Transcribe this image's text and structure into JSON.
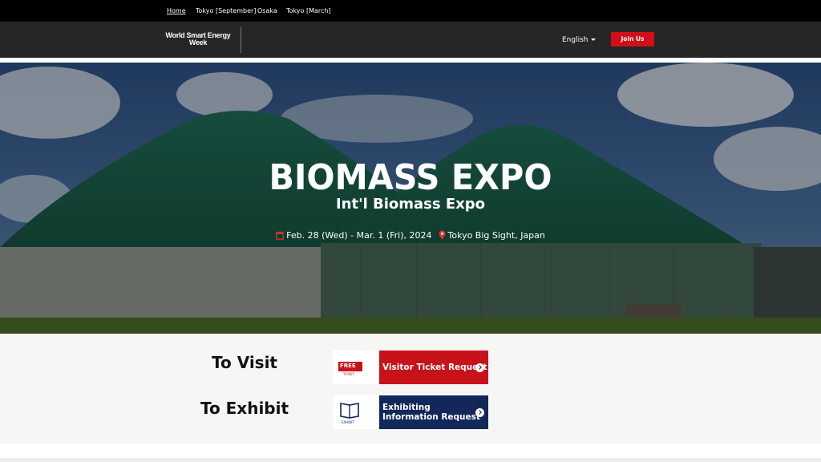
{
  "topnav": {
    "items": [
      {
        "label": "Home",
        "active": true
      },
      {
        "label": "Tokyo [September]"
      },
      {
        "label": "Osaka"
      },
      {
        "label": "Tokyo [March]"
      }
    ]
  },
  "header": {
    "logo_line1": "World Smart Energy",
    "logo_line2": "Week",
    "language": "English",
    "join_label": "Join Us"
  },
  "hero": {
    "title": "BIOMASS EXPO",
    "subtitle": "Int'l Biomass Expo",
    "date": "Feb. 28 (Wed) - Mar. 1 (Fri), 2024",
    "venue": "Tokyo Big Sight, Japan"
  },
  "cta": {
    "visit_label": "To Visit",
    "visit_badge": "FREE",
    "visit_badge_sub": "TICKET",
    "visit_button": "Visitor Ticket Request",
    "exhibit_label": "To Exhibit",
    "exhibit_badge_sub": "EXHIBIT",
    "exhibit_button_line1": "Exhibiting",
    "exhibit_button_line2": "Information Request"
  },
  "colors": {
    "accent_red": "#d10f18",
    "navy": "#13275a",
    "header_bg": "#262626",
    "topbar_bg": "#000000"
  }
}
